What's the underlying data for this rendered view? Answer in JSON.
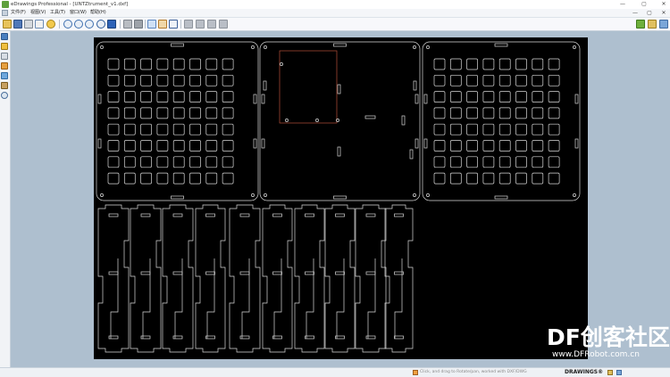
{
  "window": {
    "title": "eDrawings Professional - [UNTZtrument_v1.dxf]",
    "minimize": "—",
    "restore": "▢",
    "close": "✕"
  },
  "menu": {
    "items": [
      "文件(F)",
      "视图(V)",
      "工具(T)",
      "窗口(W)",
      "帮助(H)"
    ]
  },
  "toolbar": {
    "icons": [
      "open-icon",
      "save-icon",
      "print-icon",
      "email-icon",
      "zoom-fit-icon",
      "zoom-in-icon",
      "zoom-area-icon",
      "rotate-icon",
      "pan-icon",
      "view-3d-icon",
      "shaded-icon",
      "select-icon",
      "markup-icon",
      "measure-icon",
      "first-icon",
      "stop-icon",
      "next-icon",
      "play-icon"
    ]
  },
  "sidebar": {
    "icons": [
      "sheets-icon",
      "markup-list-icon",
      "components-icon",
      "pen-icon",
      "layers-icon",
      "stamp-icon",
      "close-icon"
    ]
  },
  "status": {
    "text": "Click, and drag to Rotate/pan, worked with DXF/DWG",
    "brand": "DRAWINGS®"
  },
  "watermark": {
    "text": "DF创客社区",
    "url": "www.DFRobot.com.cn"
  },
  "colors": {
    "canvas": "#000000",
    "lines": "#d9d9d9",
    "highlight": "#b5503a",
    "app_bg": "#aebfcf"
  }
}
